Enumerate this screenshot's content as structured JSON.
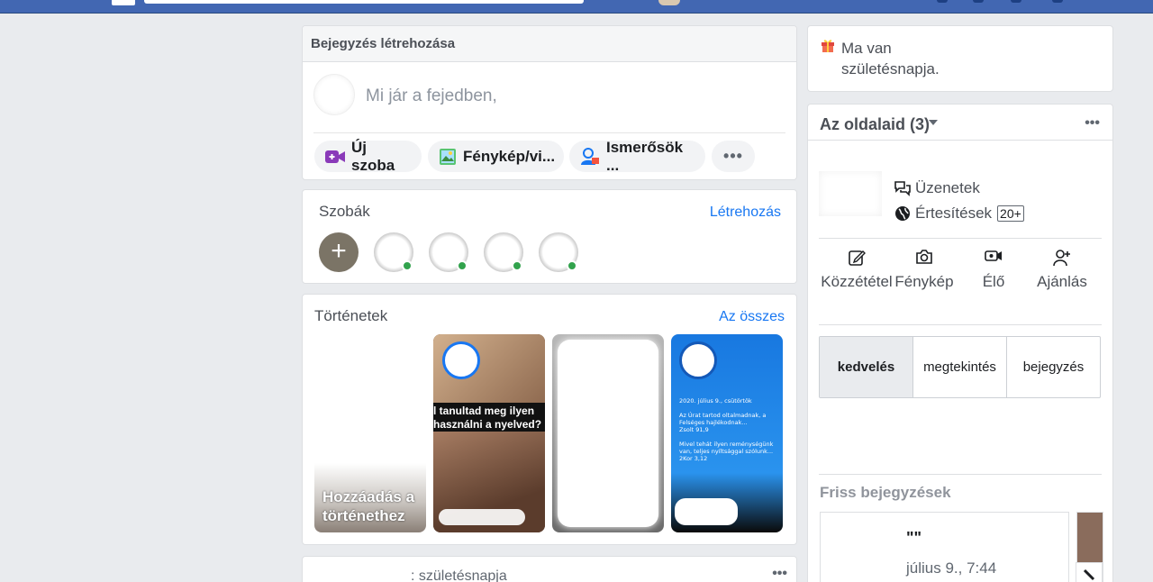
{
  "composer": {
    "title": "Bejegyzés létrehozása",
    "prompt": "Mi jár a fejedben,",
    "buttons": [
      {
        "label": "Új szoba",
        "icon": "video-room-icon"
      },
      {
        "label": "Fénykép/vi...",
        "icon": "photo-icon"
      },
      {
        "label": "Ismerősök ...",
        "icon": "tag-friends-icon"
      },
      {
        "label": "•••",
        "icon": "more-icon"
      }
    ]
  },
  "rooms": {
    "title": "Szobák",
    "create_label": "Létrehozás",
    "add_symbol": "+",
    "avatars": 4
  },
  "stories": {
    "title": "Történetek",
    "all_label": "Az összes",
    "add_label_line1": "Hozzáadás a",
    "add_label_line2": "történethez",
    "story2_text_line1": "l tanultad meg ilyen",
    "story2_text_line2": "használni a nyelved?",
    "story4_text": "2020. július 9., csütörtök\n\nAz Úrat tartod oltalmadnak, a Felséges hajlékodnak...\nZsolt 91,9\n\nMivel tehát ilyen reménységünk van, teljes nyíltsággal szólunk...\n2Kor 3,12"
  },
  "post": {
    "text": ": születésnapja",
    "more": "•••"
  },
  "birthday": {
    "line1": "Ma van",
    "line2": "születésnapja.",
    "icon": "gift-icon"
  },
  "pages": {
    "title": "Az oldalaid (3)",
    "more": "•••",
    "messages_label": "Üzenetek",
    "notifications_label": "Értesítések",
    "notifications_badge": "20+",
    "actions": [
      {
        "label": "Közzététel",
        "icon": "edit-icon"
      },
      {
        "label": "Fénykép",
        "icon": "camera-icon"
      },
      {
        "label": "Élő",
        "icon": "live-video-icon"
      },
      {
        "label": "Ajánlás",
        "icon": "invite-icon"
      }
    ],
    "tabs": [
      {
        "label": "kedvelés",
        "active": true
      },
      {
        "label": "megtekintés",
        "active": false
      },
      {
        "label": "bejegyzés",
        "active": false
      }
    ],
    "recent_title": "Friss bejegyzések",
    "recent_post_title": "\"\"",
    "recent_post_date": "július 9., 7:44"
  },
  "colors": {
    "brand": "#4267b2",
    "link": "#1877f2",
    "online": "#31a24c",
    "background": "#e9ebee"
  }
}
